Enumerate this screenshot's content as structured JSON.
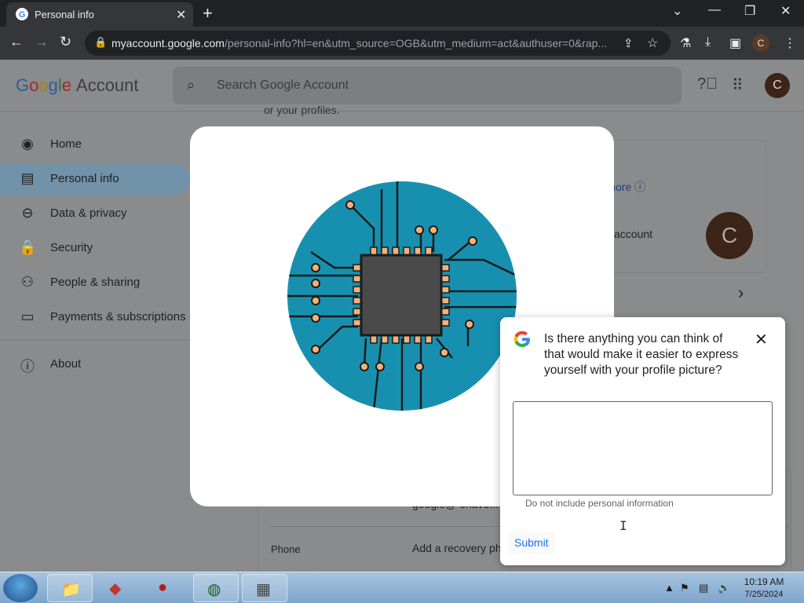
{
  "browser": {
    "tab_title": "Personal info",
    "url_host": "myaccount.google.com",
    "url_rest": "/personal-info?hl=en&utm_source=OGB&utm_medium=act&authuser=0&rap...",
    "profile_initial": "C"
  },
  "header": {
    "logo": [
      "G",
      "o",
      "o",
      "g",
      "l",
      "e"
    ],
    "logo_suffix": "Account",
    "search_placeholder": "Search Google Account",
    "avatar_initial": "C"
  },
  "sidebar": {
    "items": [
      {
        "label": "Home",
        "icon": "home-icon"
      },
      {
        "label": "Personal info",
        "icon": "id-card-icon"
      },
      {
        "label": "Data & privacy",
        "icon": "toggle-icon"
      },
      {
        "label": "Security",
        "icon": "lock-icon"
      },
      {
        "label": "People & sharing",
        "icon": "people-icon"
      },
      {
        "label": "Payments & subscriptions",
        "icon": "card-icon"
      },
      {
        "label": "About",
        "icon": "info-icon"
      }
    ]
  },
  "background": {
    "profiles_text": "or your profiles.",
    "learn_more": "rn more",
    "account_text": "account",
    "photo_initial": "C",
    "email_partial": "google@ onavo...",
    "phone_label": "Phone",
    "phone_value": "Add a recovery ph"
  },
  "feedback": {
    "question": "Is there anything you can think of that would make it easier to express yourself with your profile picture?",
    "input_value": "",
    "hint": "Do not include personal information",
    "submit_label": "Submit"
  },
  "taskbar": {
    "time": "10:19 AM",
    "date": "7/25/2024"
  },
  "colors": {
    "circuit_bg": "#1790b0",
    "chip": "#4a4a4a",
    "pad": "#f5b17a",
    "link": "#1a73e8"
  }
}
